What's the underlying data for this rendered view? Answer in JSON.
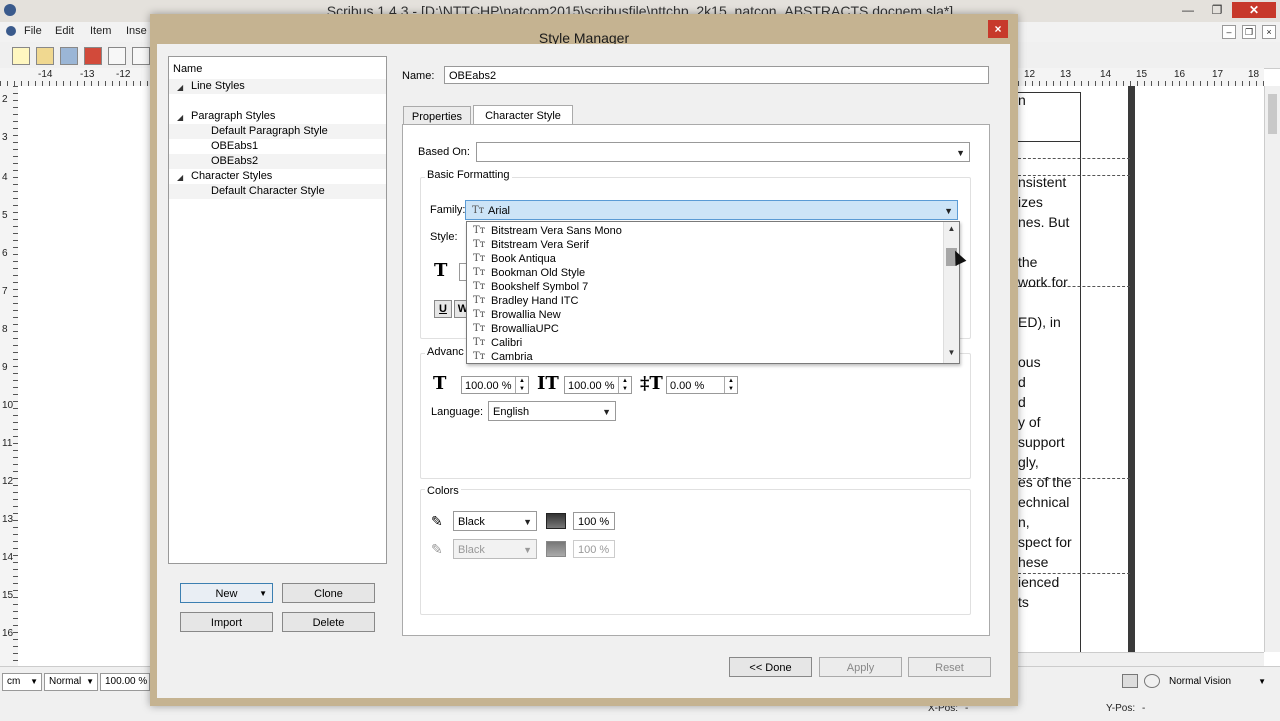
{
  "app": {
    "title": "Scribus 1.4.3 - [D:\\NTTCHP\\natcom2015\\scribusfile\\nttchp_2k15_natcon_ABSTRACTS.docnem.sla*]",
    "menu": [
      "File",
      "Edit",
      "Item",
      "Inse"
    ],
    "ruler_top_left": [
      "-14",
      "-13",
      "-12"
    ],
    "ruler_top_right": [
      "12",
      "13",
      "14",
      "15",
      "16",
      "17",
      "18"
    ],
    "ruler_left": [
      "2",
      "3",
      "4",
      "5",
      "6",
      "7",
      "8",
      "9",
      "10",
      "11",
      "12",
      "13",
      "14",
      "15",
      "16"
    ],
    "background_text": [
      "n",
      "nsistent",
      "izes",
      "nes. But",
      "the",
      "work for",
      "ED), in",
      "ous",
      "d",
      "d",
      "y of",
      "support",
      "gly,",
      "es of the",
      "echnical",
      "n,",
      "spect for",
      "hese",
      "ienced",
      "ts"
    ],
    "status": {
      "unit": "cm",
      "mode": "Normal",
      "zoom": "100.00 %",
      "xpos_label": "X-Pos:",
      "xpos_value": "-",
      "ypos_label": "Y-Pos:",
      "ypos_value": "-",
      "vision": "Normal Vision"
    },
    "controls": {
      "min": "—",
      "max": "❐",
      "close": "✕",
      "mdi_min": "–",
      "mdi_restore": "❐",
      "mdi_close": "×"
    }
  },
  "dialog": {
    "title": "Style Manager",
    "close": "×",
    "tree": {
      "header": "Name",
      "groups": [
        {
          "label": "Line Styles",
          "items": []
        },
        {
          "label": "Paragraph Styles",
          "items": [
            "Default Paragraph Style",
            "OBEabs1",
            "OBEabs2"
          ]
        },
        {
          "label": "Character Styles",
          "items": [
            "Default Character Style"
          ]
        }
      ]
    },
    "buttons": {
      "new": "New",
      "clone": "Clone",
      "import": "Import",
      "delete": "Delete",
      "done": "<< Done",
      "apply": "Apply",
      "reset": "Reset"
    },
    "name_label": "Name:",
    "name_value": "OBEabs2",
    "tabs": [
      "Properties",
      "Character Style"
    ],
    "based_on_label": "Based On:",
    "based_on_value": "",
    "basic_formatting": {
      "title": "Basic Formatting",
      "family_label": "Family:",
      "family_value": "Arial",
      "style_label": "Style:",
      "font_list": [
        "Bitstream Vera Sans Mono",
        "Bitstream Vera Serif",
        "Book Antiqua",
        "Bookman Old Style",
        "Bookshelf Symbol 7",
        "Bradley Hand ITC",
        "Browallia New",
        "BrowalliaUPC",
        "Calibri",
        "Cambria"
      ]
    },
    "advanced": {
      "title": "Advanc",
      "scale_h": "100.00 %",
      "scale_v": "100.00 %",
      "tracking": "0.00 %",
      "language_label": "Language:",
      "language_value": "English"
    },
    "colors": {
      "title": "Colors",
      "fill_color": "Black",
      "fill_shade": "100 %",
      "stroke_color": "Black",
      "stroke_shade": "100 %"
    }
  }
}
